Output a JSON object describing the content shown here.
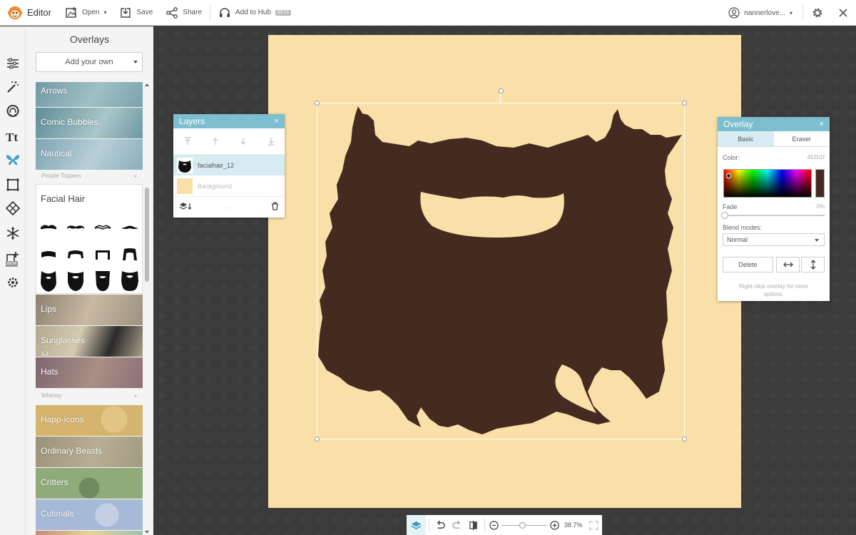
{
  "topbar": {
    "app_name": "Editor",
    "open_label": "Open",
    "save_label": "Save",
    "share_label": "Share",
    "hub_label": "Add to Hub",
    "hub_badge": "BETA",
    "username": "nannerlove..."
  },
  "rail": {
    "beta_badge": "BETA",
    "icons": [
      "sliders-icon",
      "magic-wand-icon",
      "face-icon",
      "text-icon",
      "butterfly-icon",
      "frame-icon",
      "texture-icon",
      "snowflake-icon",
      "collage-icon",
      "gear-icon"
    ]
  },
  "panel": {
    "title": "Overlays",
    "add_own": "Add your own",
    "tiles_top": [
      {
        "label": "Arrows",
        "color": "#7aa3ad"
      },
      {
        "label": "Comic Bubbles",
        "color": "#6c98a2"
      },
      {
        "label": "Nautical",
        "color": "#8aaebd"
      }
    ],
    "section_people": "People Toppers",
    "facial_hair_title": "Facial Hair",
    "tiles_people": [
      {
        "label": "Lips",
        "color": "#9d9282"
      },
      {
        "label": "Sunglasses",
        "color": "#a99f88"
      },
      {
        "label": "Hats",
        "color": "#8d6f78"
      }
    ],
    "section_whimsy": "Whimsy",
    "tiles_whimsy": [
      {
        "label": "Happ-icons",
        "color": "#d5b46d"
      },
      {
        "label": "Ordinary Beasts",
        "color": "#a39a82"
      },
      {
        "label": "Critters",
        "color": "#8fab7a"
      },
      {
        "label": "Cutimals",
        "color": "#a6b9d6"
      }
    ]
  },
  "layers_panel": {
    "title": "Layers",
    "close": "×",
    "layers": [
      {
        "name": "facialhair_12",
        "selected": true
      },
      {
        "name": "Background",
        "selected": false
      }
    ],
    "footer_dots": "....."
  },
  "overlay_panel": {
    "title": "Overlay",
    "close": "×",
    "tab_basic": "Basic",
    "tab_eraser": "Eraser",
    "color_label": "Color:",
    "color_hex": "452b1f",
    "fade_label": "Fade",
    "fade_value": "0%",
    "blend_label": "Blend modes:",
    "blend_value": "Normal",
    "delete_label": "Delete",
    "hint": "Right-click overlay for more options."
  },
  "bottombar": {
    "zoom": "38.7%"
  },
  "colors": {
    "accent": "#7dbfcf",
    "canvas": "#f9e0a8",
    "beard": "#452b1f"
  }
}
